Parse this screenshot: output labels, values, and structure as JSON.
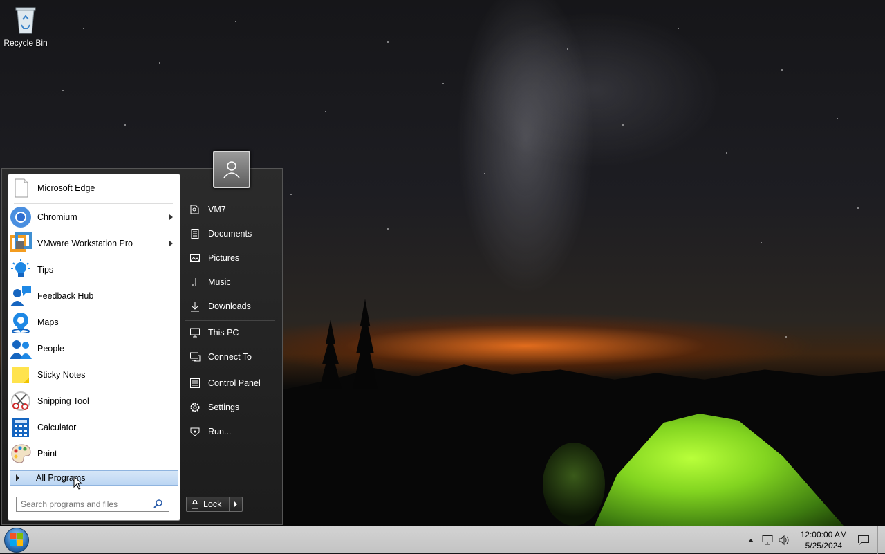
{
  "desktop": {
    "icons": [
      {
        "label": "Recycle Bin",
        "icon": "recycle-bin-icon"
      }
    ]
  },
  "start_menu": {
    "pinned": [
      {
        "label": "Microsoft Edge",
        "icon": "edge-icon"
      }
    ],
    "programs": [
      {
        "label": "Chromium",
        "icon": "chromium-icon",
        "has_submenu": true
      },
      {
        "label": "VMware Workstation Pro",
        "icon": "vmware-icon",
        "has_submenu": true
      },
      {
        "label": "Tips",
        "icon": "tips-icon"
      },
      {
        "label": "Feedback Hub",
        "icon": "feedback-hub-icon"
      },
      {
        "label": "Maps",
        "icon": "maps-icon"
      },
      {
        "label": "People",
        "icon": "people-icon"
      },
      {
        "label": "Sticky Notes",
        "icon": "sticky-notes-icon"
      },
      {
        "label": "Snipping Tool",
        "icon": "snipping-tool-icon"
      },
      {
        "label": "Calculator",
        "icon": "calculator-icon"
      },
      {
        "label": "Paint",
        "icon": "paint-icon"
      }
    ],
    "all_programs": "All Programs",
    "search_placeholder": "Search programs and files",
    "right_items": [
      {
        "label": "VM7",
        "icon": "user-folder-icon"
      },
      {
        "label": "Documents",
        "icon": "documents-icon"
      },
      {
        "label": "Pictures",
        "icon": "pictures-icon"
      },
      {
        "label": "Music",
        "icon": "music-icon"
      },
      {
        "label": "Downloads",
        "icon": "downloads-icon"
      },
      {
        "label": "This PC",
        "icon": "computer-icon"
      },
      {
        "label": "Connect To",
        "icon": "connect-icon"
      },
      {
        "label": "Control Panel",
        "icon": "control-panel-icon"
      },
      {
        "label": "Settings",
        "icon": "gear-icon"
      },
      {
        "label": "Run...",
        "icon": "run-icon"
      }
    ],
    "power_button": "Lock"
  },
  "taskbar": {
    "time": "12:00:00 AM",
    "date": "5/25/2024"
  }
}
